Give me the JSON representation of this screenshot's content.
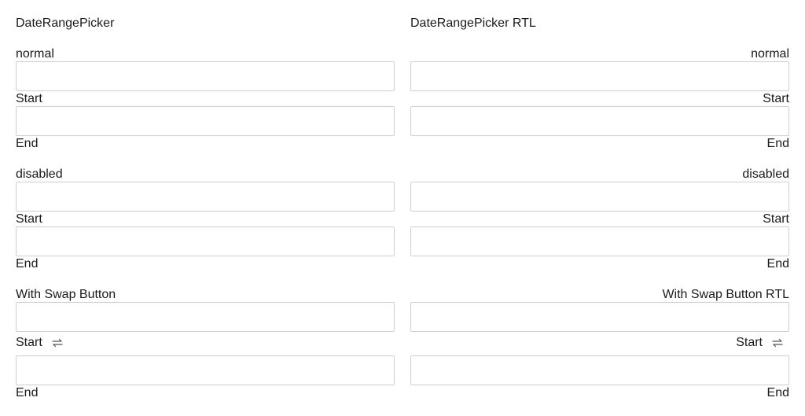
{
  "left": {
    "title": "DateRangePicker",
    "sections": [
      {
        "label": "normal",
        "start_label": "Start",
        "end_label": "End"
      },
      {
        "label": "disabled",
        "start_label": "Start",
        "end_label": "End"
      },
      {
        "label": "With Swap Button",
        "start_label": "Start",
        "end_label": "End"
      }
    ]
  },
  "right": {
    "title": "DateRangePicker RTL",
    "sections": [
      {
        "label": "normal",
        "start_label": "Start",
        "end_label": "End"
      },
      {
        "label": "disabled",
        "start_label": "Start",
        "end_label": "End"
      },
      {
        "label": "With Swap Button RTL",
        "start_label": "Start",
        "end_label": "End"
      }
    ]
  },
  "icons": {
    "swap": "swap-arrows-icon"
  }
}
